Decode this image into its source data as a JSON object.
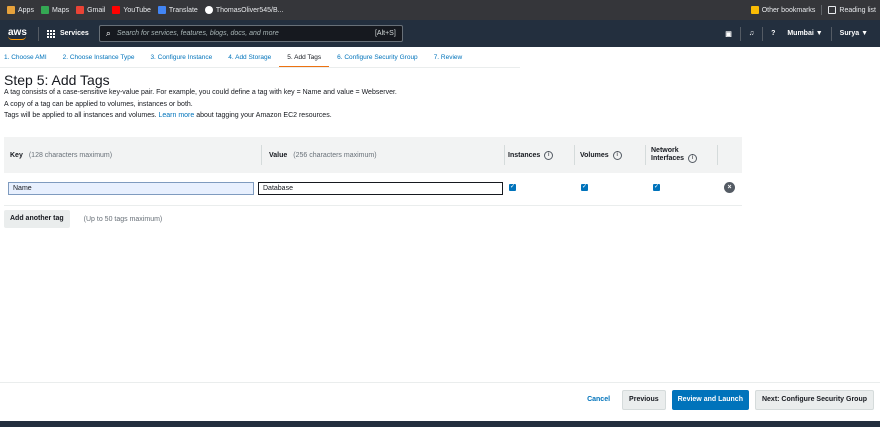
{
  "bookmarks": [
    {
      "label": "Apps",
      "color": "#e8a23b"
    },
    {
      "label": "Maps",
      "color": "#34a853"
    },
    {
      "label": "Gmail",
      "color": "#ea4335"
    },
    {
      "label": "YouTube",
      "color": "#ff0000"
    },
    {
      "label": "Translate",
      "color": "#4285f4"
    },
    {
      "label": "ThomasOliver545/B...",
      "color": "#ffffff"
    }
  ],
  "bookmarks_right": {
    "other": "Other bookmarks",
    "reading": "Reading list"
  },
  "aws": {
    "logo": "aws",
    "services": "Services",
    "search_placeholder": "Search for services, features, blogs, docs, and more",
    "search_shortcut": "[Alt+S]",
    "region": "Mumbai ▼",
    "user": "Surya ▼",
    "accent": "#ff9900"
  },
  "wizard": {
    "steps": [
      "1. Choose AMI",
      "2. Choose Instance Type",
      "3. Configure Instance",
      "4. Add Storage",
      "5. Add Tags",
      "6. Configure Security Group",
      "7. Review"
    ],
    "active_index": 4
  },
  "page": {
    "title": "Step 5: Add Tags",
    "desc1": "A tag consists of a case-sensitive key-value pair. For example, you could define a tag with key = Name and value = Webserver.",
    "desc2": "A copy of a tag can be applied to volumes, instances or both.",
    "desc3_pre": "Tags will be applied to all instances and volumes.",
    "desc3_link": "Learn more",
    "desc3_post": "about tagging your Amazon EC2 resources."
  },
  "table": {
    "key_header": "Key",
    "key_hint": "(128 characters maximum)",
    "value_header": "Value",
    "value_hint": "(256 characters maximum)",
    "instances_header": "Instances",
    "volumes_header": "Volumes",
    "ni_header_1": "Network",
    "ni_header_2": "Interfaces",
    "rows": [
      {
        "key": "Name",
        "value": "Database",
        "instances": true,
        "volumes": true,
        "network_interfaces": true
      }
    ]
  },
  "add_tag": {
    "label": "Add another tag",
    "hint": "(Up to 50 tags maximum)"
  },
  "actions": {
    "cancel": "Cancel",
    "previous": "Previous",
    "review": "Review and Launch",
    "next": "Next: Configure Security Group"
  }
}
